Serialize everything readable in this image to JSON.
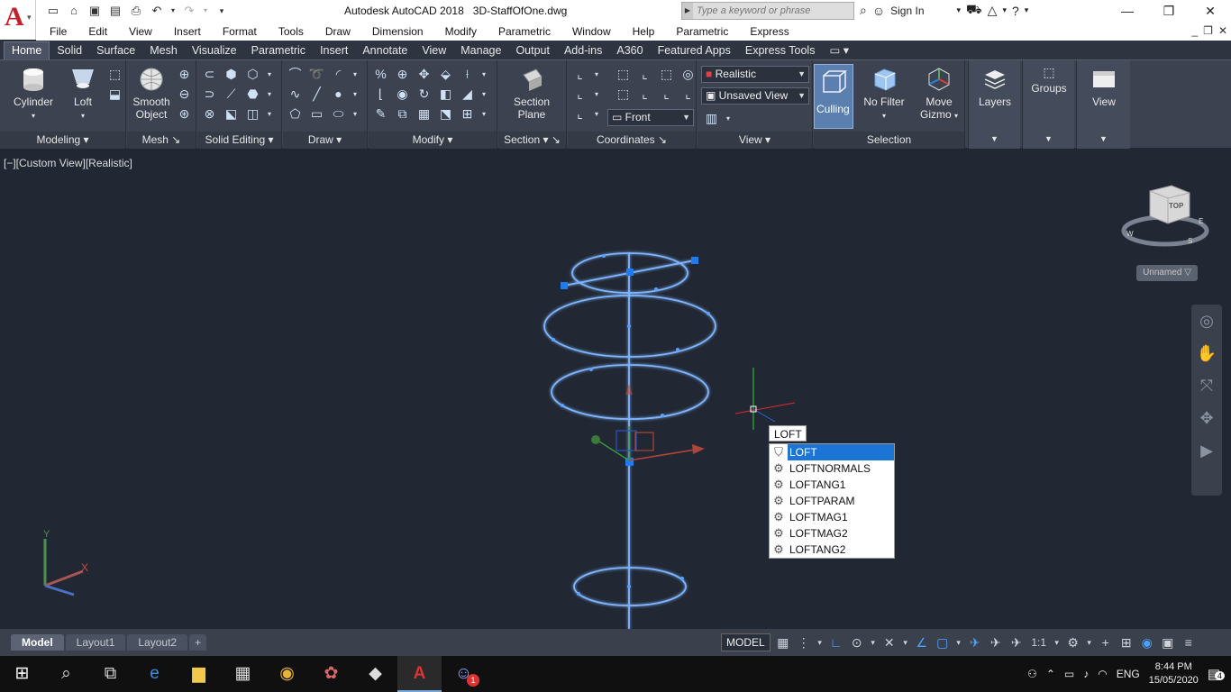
{
  "title": {
    "app": "Autodesk AutoCAD 2018",
    "file": "3D-StaffOfOne.dwg",
    "search_placeholder": "Type a keyword or phrase",
    "sign_in": "Sign In"
  },
  "menubar": [
    "File",
    "Edit",
    "View",
    "Insert",
    "Format",
    "Tools",
    "Draw",
    "Dimension",
    "Modify",
    "Parametric",
    "Window",
    "Help",
    "Parametric",
    "Express"
  ],
  "ribbon_tabs": [
    "Home",
    "Solid",
    "Surface",
    "Mesh",
    "Visualize",
    "Parametric",
    "Insert",
    "Annotate",
    "View",
    "Manage",
    "Output",
    "Add-ins",
    "A360",
    "Featured Apps",
    "Express Tools"
  ],
  "ribbon": {
    "cylinder": "Cylinder",
    "loft": "Loft",
    "smooth_object_1": "Smooth",
    "smooth_object_2": "Object",
    "section_plane_1": "Section",
    "section_plane_2": "Plane",
    "visual_style": "Realistic",
    "view_name": "Unsaved View",
    "ucs_view": "Front",
    "culling": "Culling",
    "no_filter": "No Filter",
    "move_gizmo_1": "Move",
    "move_gizmo_2": "Gizmo",
    "layers": "Layers",
    "groups": "Groups",
    "view": "View",
    "panels": {
      "modeling": "Modeling",
      "mesh": "Mesh",
      "solid_editing": "Solid Editing",
      "draw": "Draw",
      "modify": "Modify",
      "section": "Section",
      "coordinates": "Coordinates",
      "view": "View",
      "selection": "Selection"
    }
  },
  "viewport": {
    "label": "[−][Custom View][Realistic]",
    "viewcube_face": "TOP",
    "compass_w": "W",
    "compass_s": "S",
    "compass_e": "E",
    "ucs_label": "Unnamed",
    "axis_x": "X",
    "axis_y": "Y"
  },
  "command": {
    "typed": "LOFT",
    "suggestions": [
      "LOFT",
      "LOFTNORMALS",
      "LOFTANG1",
      "LOFTPARAM",
      "LOFTMAG1",
      "LOFTMAG2",
      "LOFTANG2"
    ],
    "selected_index": 0
  },
  "layout_tabs": [
    "Model",
    "Layout1",
    "Layout2",
    "+"
  ],
  "status": {
    "model": "MODEL",
    "scale": "1:1"
  },
  "taskbar": {
    "lang": "ENG",
    "time": "8:44 PM",
    "date": "15/05/2020",
    "notifications": "4",
    "badge": "1"
  },
  "colors": {
    "viewport_bg": "#212833",
    "ribbon_bg": "#3c4250",
    "accent": "#1c74d4",
    "wire": "#7fb4ff"
  }
}
